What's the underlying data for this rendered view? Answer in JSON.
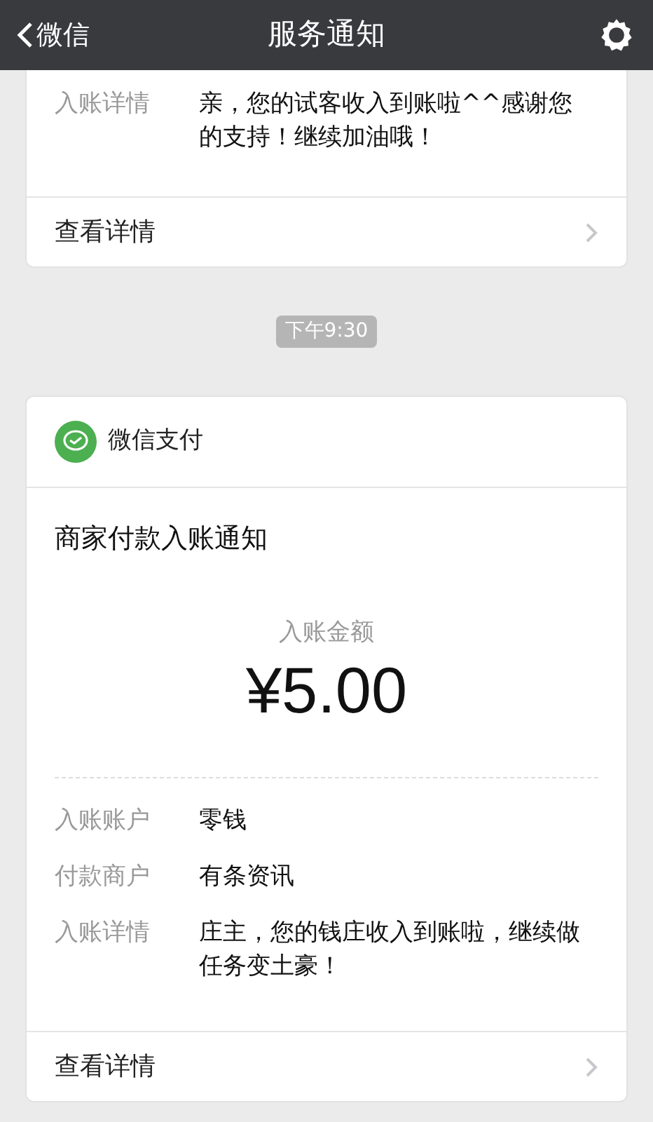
{
  "nav": {
    "back_label": "微信",
    "title": "服务通知"
  },
  "feed": [
    {
      "kind": "card",
      "rows": [
        {
          "label": "入账详情",
          "value": "亲，您的试客收入到账啦^^感谢您的支持！继续加油哦！"
        }
      ],
      "link": "查看详情"
    },
    {
      "kind": "time",
      "text": "下午9:30"
    },
    {
      "kind": "card",
      "source": "微信支付",
      "title": "商家付款入账通知",
      "amount_label": "入账金额",
      "amount": "¥5.00",
      "rows": [
        {
          "label": "入账账户",
          "value": "零钱"
        },
        {
          "label": "付款商户",
          "value": "有条资讯"
        },
        {
          "label": "入账详情",
          "value": "庄主，您的钱庄收入到账啦，继续做任务变土豪！"
        }
      ],
      "link": "查看详情"
    }
  ]
}
